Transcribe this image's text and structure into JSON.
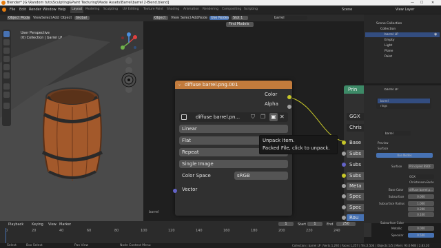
{
  "window": {
    "title": "Blender* [G:\\Random tuto\\Sculpting&Paint Texturing\\Made Assets\\Barrel\\barrel 2-Blend.blend]"
  },
  "menu": {
    "items": [
      "File",
      "Edit",
      "Render",
      "Window",
      "Help"
    ],
    "workspaces": [
      "Layout",
      "Modeling",
      "Sculpting",
      "UV Editing",
      "Texture Paint",
      "Shading",
      "Animation",
      "Rendering",
      "Compositing",
      "Scripting"
    ],
    "active_workspace": "Layout",
    "scene_label": "Scene",
    "view_layer_label": "View Layer"
  },
  "viewport": {
    "mode": "Object Mode",
    "view_menu": "View",
    "select_menu": "Select",
    "add_menu": "Add",
    "object_menu": "Object",
    "perspective_label": "User Perspective",
    "collection_label": "(0) Collection | barrel LP",
    "global_label": "Global"
  },
  "node_editor": {
    "editor_type": "Object",
    "view_menu": "View",
    "select_menu": "Select",
    "add_menu": "Add",
    "node_menu": "Node",
    "use_nodes_label": "Use Nodes",
    "slot_label": "Slot 1",
    "material_name": "barrel",
    "find_models_label": "Find Models",
    "object_label": "barrel"
  },
  "image_node": {
    "title": "diffuse barrel.png.001",
    "output_color": "Color",
    "output_alpha": "Alpha",
    "image_name": "diffuse barrel.pn...",
    "interpolation": "Linear",
    "projection": "Flat",
    "extension": "Repeat",
    "source": "Single Image",
    "color_space_label": "Color Space",
    "color_space_value": "sRGB",
    "input_vector": "Vector"
  },
  "tooltip": {
    "line1": "Unpack Item.",
    "line2": "Packed File, click to unpack."
  },
  "principled_node": {
    "title": "Prin",
    "rows": [
      "GGX",
      "Chris",
      "Base",
      "Subs",
      "Subs",
      "Subs",
      "Meta",
      "Spec",
      "Spec",
      "Rou"
    ]
  },
  "outliner": {
    "title": "Scene Collection",
    "items": [
      "Scene Collection",
      "Collection",
      "barrel LP",
      "Empty",
      "Light",
      "Plane",
      "Point"
    ]
  },
  "properties": {
    "object_name": "barrel LP",
    "material_slots": [
      "barrel",
      "rings"
    ],
    "material_name": "barrel",
    "section_preview": "Preview",
    "section_surface": "Surface",
    "use_nodes_label": "Use Nodes",
    "surface_label": "Surface",
    "surface_value": "Principled BSDF",
    "distribution_value": "GGX",
    "subsurface_method_value": "Christensen-Burle",
    "base_color_label": "Base Color",
    "base_color_value": "diffuse barrel.p...",
    "subsurface_label": "Subsurface",
    "subsurface_value": "0.000",
    "subsurface_radius_label": "Subsurface Radius",
    "subsurface_radius_values": [
      "1.000",
      "0.200",
      "0.100"
    ],
    "subsurface_color_label": "Subsurface Color",
    "metallic_label": "Metallic",
    "metallic_value": "0.000",
    "specular_label": "Specular",
    "specular_value": "0.500"
  },
  "timeline": {
    "playback": "Playback",
    "keying": "Keying",
    "view": "View",
    "marker": "Marker",
    "current_frame": "1",
    "start_label": "Start",
    "start_value": "1",
    "end_label": "End",
    "end_value": "250",
    "ticks": [
      "0",
      "20",
      "40",
      "60",
      "80",
      "100",
      "120",
      "140",
      "160",
      "180",
      "200",
      "220",
      "240"
    ]
  },
  "statusbar": {
    "select": "Select",
    "box_select": "Box Select",
    "pan_view": "Pan View",
    "context_menu": "Node Context Menu",
    "stats": "Collection | barrel LP | Verts:1,292 | Faces:1,257 | Tris:2,504 | Objects:1/5 | Mem: 93.6 MiB | 2.83.20"
  },
  "colors": {
    "image_node_header": "#c27b3c",
    "principled_header": "#3d8a67",
    "accent_blue": "#4772b3",
    "socket_yellow": "#c7c729",
    "socket_grey": "#a1a1a1",
    "socket_blue": "#6363c7"
  },
  "icons": [
    "blender-logo-icon",
    "image-icon",
    "shield-icon",
    "duplicate-icon",
    "package-icon",
    "close-icon",
    "chevron-down-icon",
    "camera-icon",
    "eye-icon",
    "hand-icon",
    "zoom-icon",
    "grid-icon"
  ]
}
